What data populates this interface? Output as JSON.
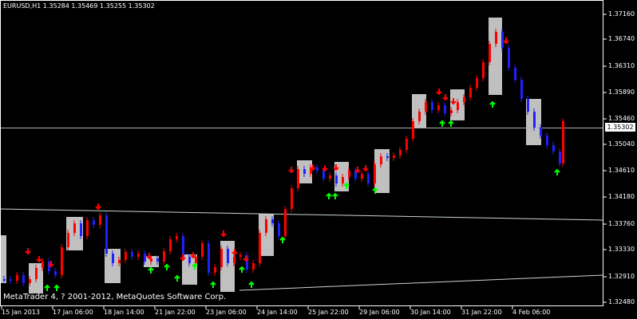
{
  "chart": {
    "symbol_info": "EURUSD,H1  1.35284 1.35469 1.35255 1.35302",
    "current_price": "1.35302",
    "copyright": "MetaTrader 4, ? 2001-2012, MetaQuotes Software Corp.",
    "price_labels": [
      "1.37160",
      "1.36740",
      "1.36310",
      "1.35890",
      "1.35460",
      "1.35040",
      "1.34610",
      "1.34180",
      "1.33760",
      "1.33330",
      "1.32910",
      "1.32480"
    ],
    "time_labels": [
      "15 Jan 2013",
      "17 Jan 06:00",
      "18 Jan 14:00",
      "21 Jan 22:00",
      "23 Jan 06:00",
      "24 Jan 14:00",
      "25 Jan 22:00",
      "29 Jan 06:00",
      "30 Jan 14:00",
      "31 Jan 22:00",
      "4 Feb 06:00"
    ]
  },
  "colors": {
    "background": "#000000",
    "axis": "#ffffff",
    "bull_candle": "#ff0000",
    "bear_candle": "#2020ff",
    "box_fill": "#c0c0c0",
    "up_arrow": "#00ff00",
    "down_arrow": "#ff0000",
    "trend_line": "#c8d8c8"
  }
}
